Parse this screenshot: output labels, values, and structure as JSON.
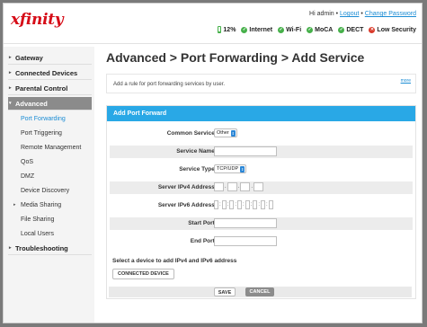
{
  "brand": {
    "logo": "xfinity",
    "logo_color": "#d60d18"
  },
  "topbar": {
    "greeting": "Hi admin",
    "separator": "•",
    "logout": "Logout",
    "change_password": "Change Password"
  },
  "status": {
    "battery": "12%",
    "internet": "Internet",
    "wifi": "Wi-Fi",
    "moca": "MoCA",
    "dect": "DECT",
    "security": "Low Security"
  },
  "sidebar": {
    "gateway": "Gateway",
    "connected_devices": "Connected Devices",
    "parental_control": "Parental Control",
    "advanced": "Advanced",
    "sub": {
      "port_forwarding": "Port Forwarding",
      "port_triggering": "Port Triggering",
      "remote_management": "Remote Management",
      "qos": "QoS",
      "dmz": "DMZ",
      "device_discovery": "Device Discovery",
      "media_sharing": "Media Sharing",
      "file_sharing": "File Sharing",
      "local_users": "Local Users"
    },
    "troubleshooting": "Troubleshooting"
  },
  "page": {
    "title": "Advanced > Port Forwarding > Add Service",
    "info_text": "Add a rule for port forwarding services by user.",
    "more": "more"
  },
  "form": {
    "header": "Add Port Forward",
    "common_service_label": "Common Service:",
    "common_service_value": "Other",
    "service_name_label": "Service Name:",
    "service_name_value": "",
    "service_type_label": "Service Type:",
    "service_type_value": "TCP/UDP",
    "ipv4_label": "Server IPv4 Address:",
    "ipv6_label": "Server IPv6 Address:",
    "start_port_label": "Start Port:",
    "start_port_value": "",
    "end_port_label": "End Port:",
    "end_port_value": "",
    "select_note": "Select a device to add IPv4 and IPv6 address",
    "connected_device_button": "CONNECTED DEVICE",
    "save": "SAVE",
    "cancel": "CANCEL"
  },
  "colors": {
    "accent": "#29a8e6",
    "link": "#1a8cd4",
    "ok": "#46b04a",
    "alert": "#d93b2b",
    "active_nav": "#8b8b8b"
  }
}
